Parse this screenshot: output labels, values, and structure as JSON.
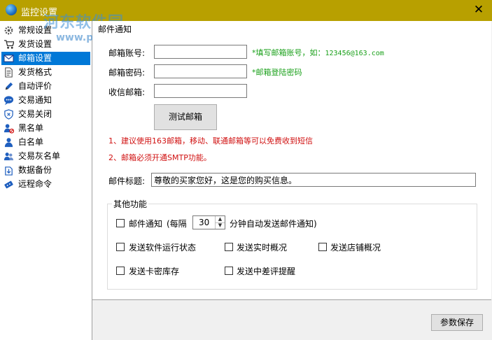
{
  "window": {
    "title": "监控设置",
    "close_glyph": "✕",
    "watermark_main": "河东软件园",
    "watermark_url": "www.pc0359.cn"
  },
  "sidebar": {
    "items": [
      {
        "label": "常规设置",
        "icon": "gear-icon"
      },
      {
        "label": "发货设置",
        "icon": "cart-icon"
      },
      {
        "label": "邮箱设置",
        "icon": "mail-icon",
        "selected": true
      },
      {
        "label": "发货格式",
        "icon": "document-icon"
      },
      {
        "label": "自动评价",
        "icon": "pencil-icon"
      },
      {
        "label": "交易通知",
        "icon": "chat-icon"
      },
      {
        "label": "交易关闭",
        "icon": "shield-icon"
      },
      {
        "label": "黑名单",
        "icon": "user-block-icon"
      },
      {
        "label": "白名单",
        "icon": "user-icon"
      },
      {
        "label": "交易灰名单",
        "icon": "users-icon"
      },
      {
        "label": "数据备份",
        "icon": "backup-icon"
      },
      {
        "label": "远程命令",
        "icon": "remote-icon"
      }
    ]
  },
  "mail": {
    "group_title": "邮件通知",
    "account_label": "邮箱账号:",
    "account_value": "",
    "account_hint_prefix": "*填写邮箱账号，如：",
    "account_hint_example": "123456@163.com",
    "password_label": "邮箱密码:",
    "password_value": "",
    "password_hint": "*邮箱登陆密码",
    "recipient_label": "收信邮箱:",
    "recipient_value": "",
    "test_button": "测试邮箱",
    "note1": "1、建议使用163邮箱，移动、联通邮箱等可以免费收到短信",
    "note2": "2、邮箱必须开通SMTP功能。",
    "subject_label": "邮件标题:",
    "subject_value": "尊敬的买家您好，这是您的购买信息。"
  },
  "other": {
    "legend": "其他功能",
    "notify_label": "邮件通知",
    "notify_prefix": "(每隔",
    "notify_interval": "30",
    "notify_suffix": "分钟自动发送邮件通知)",
    "opt_run_status": "发送软件运行状态",
    "opt_realtime": "发送实时概况",
    "opt_store": "发送店铺概况",
    "opt_card_stock": "发送卡密库存",
    "opt_bad_review": "发送中差评提醒"
  },
  "footer": {
    "save_button": "参数保存"
  },
  "colors": {
    "titlebar": "#b8a000",
    "selection": "#0078d7",
    "hint_green": "#1aa01a",
    "note_red": "#d01010"
  }
}
